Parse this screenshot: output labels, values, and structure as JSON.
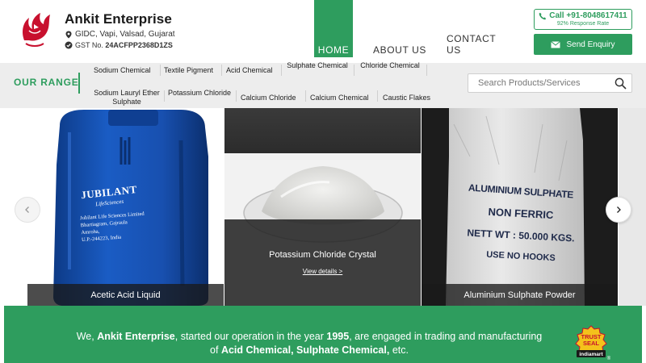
{
  "company": {
    "name": "Ankit Enterprise",
    "location": "GIDC, Vapi, Valsad, Gujarat",
    "gst_label": "GST No.",
    "gst_number": "24ACFPP2368D1ZS"
  },
  "nav": {
    "home": "HOME",
    "about": "ABOUT US",
    "contact": "CONTACT US"
  },
  "call": {
    "phone": "Call +91-8048617411",
    "response_rate": "92% Response Rate"
  },
  "enquiry_label": "Send Enquiry",
  "range": {
    "title": "OUR RANGE",
    "row1": [
      "Sodium Chemical",
      "Textile Pigment",
      "Acid Chemical",
      "Sulphate Chemical",
      "Chloride Chemical"
    ],
    "row2": [
      "Sodium Lauryl Ether Sulphate",
      "Potassium Chloride",
      "Calcium Chloride",
      "Calcium Chemical",
      "Caustic Flakes"
    ]
  },
  "search": {
    "placeholder": "Search Products/Services"
  },
  "slides": [
    {
      "caption": "Acetic Acid Liquid",
      "label_brand": "JUBILANT",
      "label_sub": "LifeSciences",
      "label_lines": [
        "Jubilant Life Sciences Limited",
        "Bhartiagram, Gajraula",
        "Amroha,",
        "U.P.-244223, India"
      ]
    },
    {
      "caption": "Potassium Chloride Crystal",
      "view_details": "View details >"
    },
    {
      "caption": "Aluminium Sulphate Powder",
      "bag_lines": [
        "ALUMINIUM SULPHATE",
        "NON FERRIC",
        "NETT WT : 50.000 KGS.",
        "USE NO HOOKS"
      ]
    }
  ],
  "about": {
    "intro": "We,",
    "company": "Ankit Enterprise",
    "mid": ", started our operation in the year",
    "year": "1995",
    "end1": ", are engaged in trading and manufacturing",
    "of": "of",
    "products": "Acid Chemical, Sulphate Chemical,",
    "etc": "etc."
  },
  "trust_seal": {
    "line1": "TRUST",
    "line2": "SEAL",
    "line3": "indiamart"
  },
  "colors": {
    "accent": "#2e9d5e",
    "header_bg": "#ffffff",
    "range_bg": "#ededed",
    "brand_red": "#c8102e"
  }
}
